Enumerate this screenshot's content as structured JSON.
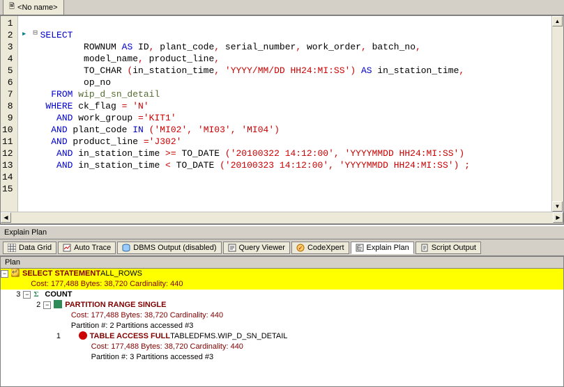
{
  "file_tab": {
    "label": "<No name>"
  },
  "editor": {
    "line_numbers": [
      "1",
      "2",
      "3",
      "4",
      "5",
      "6",
      "7",
      "8",
      "9",
      "10",
      "11",
      "12",
      "13",
      "14",
      "15"
    ],
    "indicators": {
      "2": "▸"
    },
    "fold": {
      "2": "⊟"
    },
    "sql": {
      "l02_a": "SELECT",
      "l03_a": "        ROWNUM ",
      "l03_b": "AS",
      "l03_c": " ID",
      "l03_d": ",",
      "l03_e": " plant_code",
      "l03_f": ",",
      "l03_g": " serial_number",
      "l03_h": ",",
      "l03_i": " work_order",
      "l03_j": ",",
      "l03_k": " batch_no",
      "l03_l": ",",
      "l04_a": "        model_name",
      "l04_b": ",",
      "l04_c": " product_line",
      "l04_d": ",",
      "l05_a": "        TO_CHAR ",
      "l05_b": "(",
      "l05_c": "in_station_time",
      "l05_d": ",",
      "l05_e": " 'YYYY/MM/DD HH24:MI:SS'",
      "l05_f": ")",
      "l05_g": " AS",
      "l05_h": " in_station_time",
      "l05_i": ",",
      "l06_a": "        op_no",
      "l07_a": "  FROM",
      "l07_b": " wip_d_sn_detail",
      "l08_a": " WHERE",
      "l08_b": " ck_flag ",
      "l08_c": "=",
      "l08_d": " 'N'",
      "l09_a": "   AND",
      "l09_b": " work_group ",
      "l09_c": "=",
      "l09_d": "'KIT1'",
      "l10_a": "  AND",
      "l10_b": " plant_code ",
      "l10_c": "IN",
      "l10_d": " (",
      "l10_e": "'MI02'",
      "l10_f": ",",
      "l10_g": " 'MI03'",
      "l10_h": ",",
      "l10_i": " 'MI04'",
      "l10_j": ")",
      "l11_a": "  AND",
      "l11_b": " product_line ",
      "l11_c": "=",
      "l11_d": "'J302'",
      "l12_a": "   AND",
      "l12_b": " in_station_time ",
      "l12_c": ">=",
      "l12_d": " TO_DATE ",
      "l12_e": "(",
      "l12_f": "'20100322 14:12:00'",
      "l12_g": ",",
      "l12_h": " 'YYYYMMDD HH24:MI:SS'",
      "l12_i": ")",
      "l13_a": "   AND",
      "l13_b": " in_station_time ",
      "l13_c": "<",
      "l13_d": " TO_DATE ",
      "l13_e": "(",
      "l13_f": "'20100323 14:12:00'",
      "l13_g": ",",
      "l13_h": " 'YYYYMMDD HH24:MI:SS'",
      "l13_i": ")",
      "l13_j": " ;"
    }
  },
  "pane_label": "Explain Plan",
  "result_tabs": {
    "data_grid": "Data Grid",
    "auto_trace": "Auto Trace",
    "dbms_output": "DBMS Output (disabled)",
    "query_viewer": "Query Viewer",
    "codexpert": "CodeXpert",
    "explain_plan": "Explain Plan",
    "script_output": "Script Output"
  },
  "plan": {
    "header": "Plan",
    "rows": [
      {
        "id": "",
        "op": "SELECT STATEMENT",
        "sub": "  ALL_ROWS"
      },
      {
        "detail": "Cost: 177,488  Bytes: 38,720  Cardinality: 440"
      },
      {
        "id": "3",
        "op_gray": "COUNT"
      },
      {
        "id": "2",
        "op": "PARTITION RANGE SINGLE"
      },
      {
        "detail": "Cost: 177,488  Bytes: 38,720  Cardinality: 440"
      },
      {
        "detail2": "Partition #: 2  Partitions accessed #3"
      },
      {
        "id": "1",
        "op": "TABLE ACCESS FULL",
        "sub": " TABLE ",
        "obj": "DFMS.WIP_D_SN_DETAIL"
      },
      {
        "detail": "Cost: 177,488  Bytes: 38,720  Cardinality: 440"
      },
      {
        "detail2": "Partition #: 3  Partitions accessed #3"
      }
    ]
  }
}
